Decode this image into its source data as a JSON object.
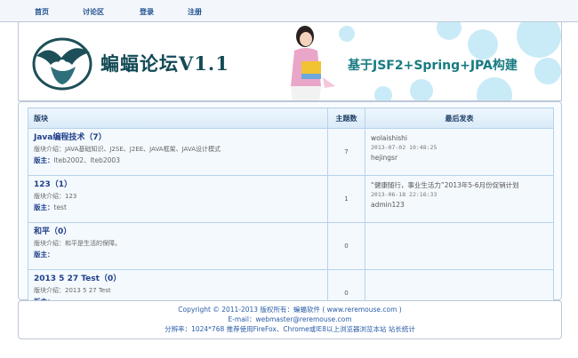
{
  "nav": {
    "items": [
      {
        "label": "首页"
      },
      {
        "label": "讨论区"
      },
      {
        "label": "登录"
      },
      {
        "label": "注册"
      }
    ]
  },
  "banner": {
    "title": "蝙蝠论坛V1.1",
    "slogan": "基于JSF2+Spring+JPA构建"
  },
  "table": {
    "headers": {
      "board": "版块",
      "count": "主题数",
      "last": "最后发表"
    },
    "rows": [
      {
        "name": "Java编程技术（7）",
        "desc": "版块介绍：JAVA基础知识、J2SE、J2EE、JAVA框架、JAVA设计模式",
        "mod_label": "版主：",
        "mods": "lteb2002、lteb2003",
        "count": "7",
        "last_title": "wolaishishi",
        "last_time": "2013-07-02 10:48:25",
        "last_user": "hejingsr"
      },
      {
        "name": "123（1）",
        "desc": "版块介绍：123",
        "mod_label": "版主：",
        "mods": "test",
        "count": "1",
        "last_title": "“健康随行，事业生活力”2013年5-6月份促销计划",
        "last_time": "2013-06-18 22:16:33",
        "last_user": "admin123"
      },
      {
        "name": "和平（0）",
        "desc": "版块介绍：和平是生活的保障。",
        "mod_label": "版主：",
        "mods": "",
        "count": "0",
        "last_title": "",
        "last_time": "",
        "last_user": ""
      },
      {
        "name": "2013 5 27 Test（0）",
        "desc": "版块介绍：2013 5 27 Test",
        "mod_label": "版主：",
        "mods": "",
        "count": "0",
        "last_title": "",
        "last_time": "",
        "last_user": ""
      }
    ]
  },
  "footer": {
    "copyright": "Copyright © 2011-2013 版权所有：蝙蝠软件 ( www.reremouse.com )",
    "email": "E-mail：webmaster@reremouse.com",
    "resolution_text": "分辨率：1024*768  推荐使用FireFox、Chrome或IE8以上浏览器浏览本站",
    "stats_link": "站长统计"
  },
  "colors": {
    "link": "#1f3f8a",
    "accent": "#177c82",
    "border": "#b7d2ea"
  }
}
